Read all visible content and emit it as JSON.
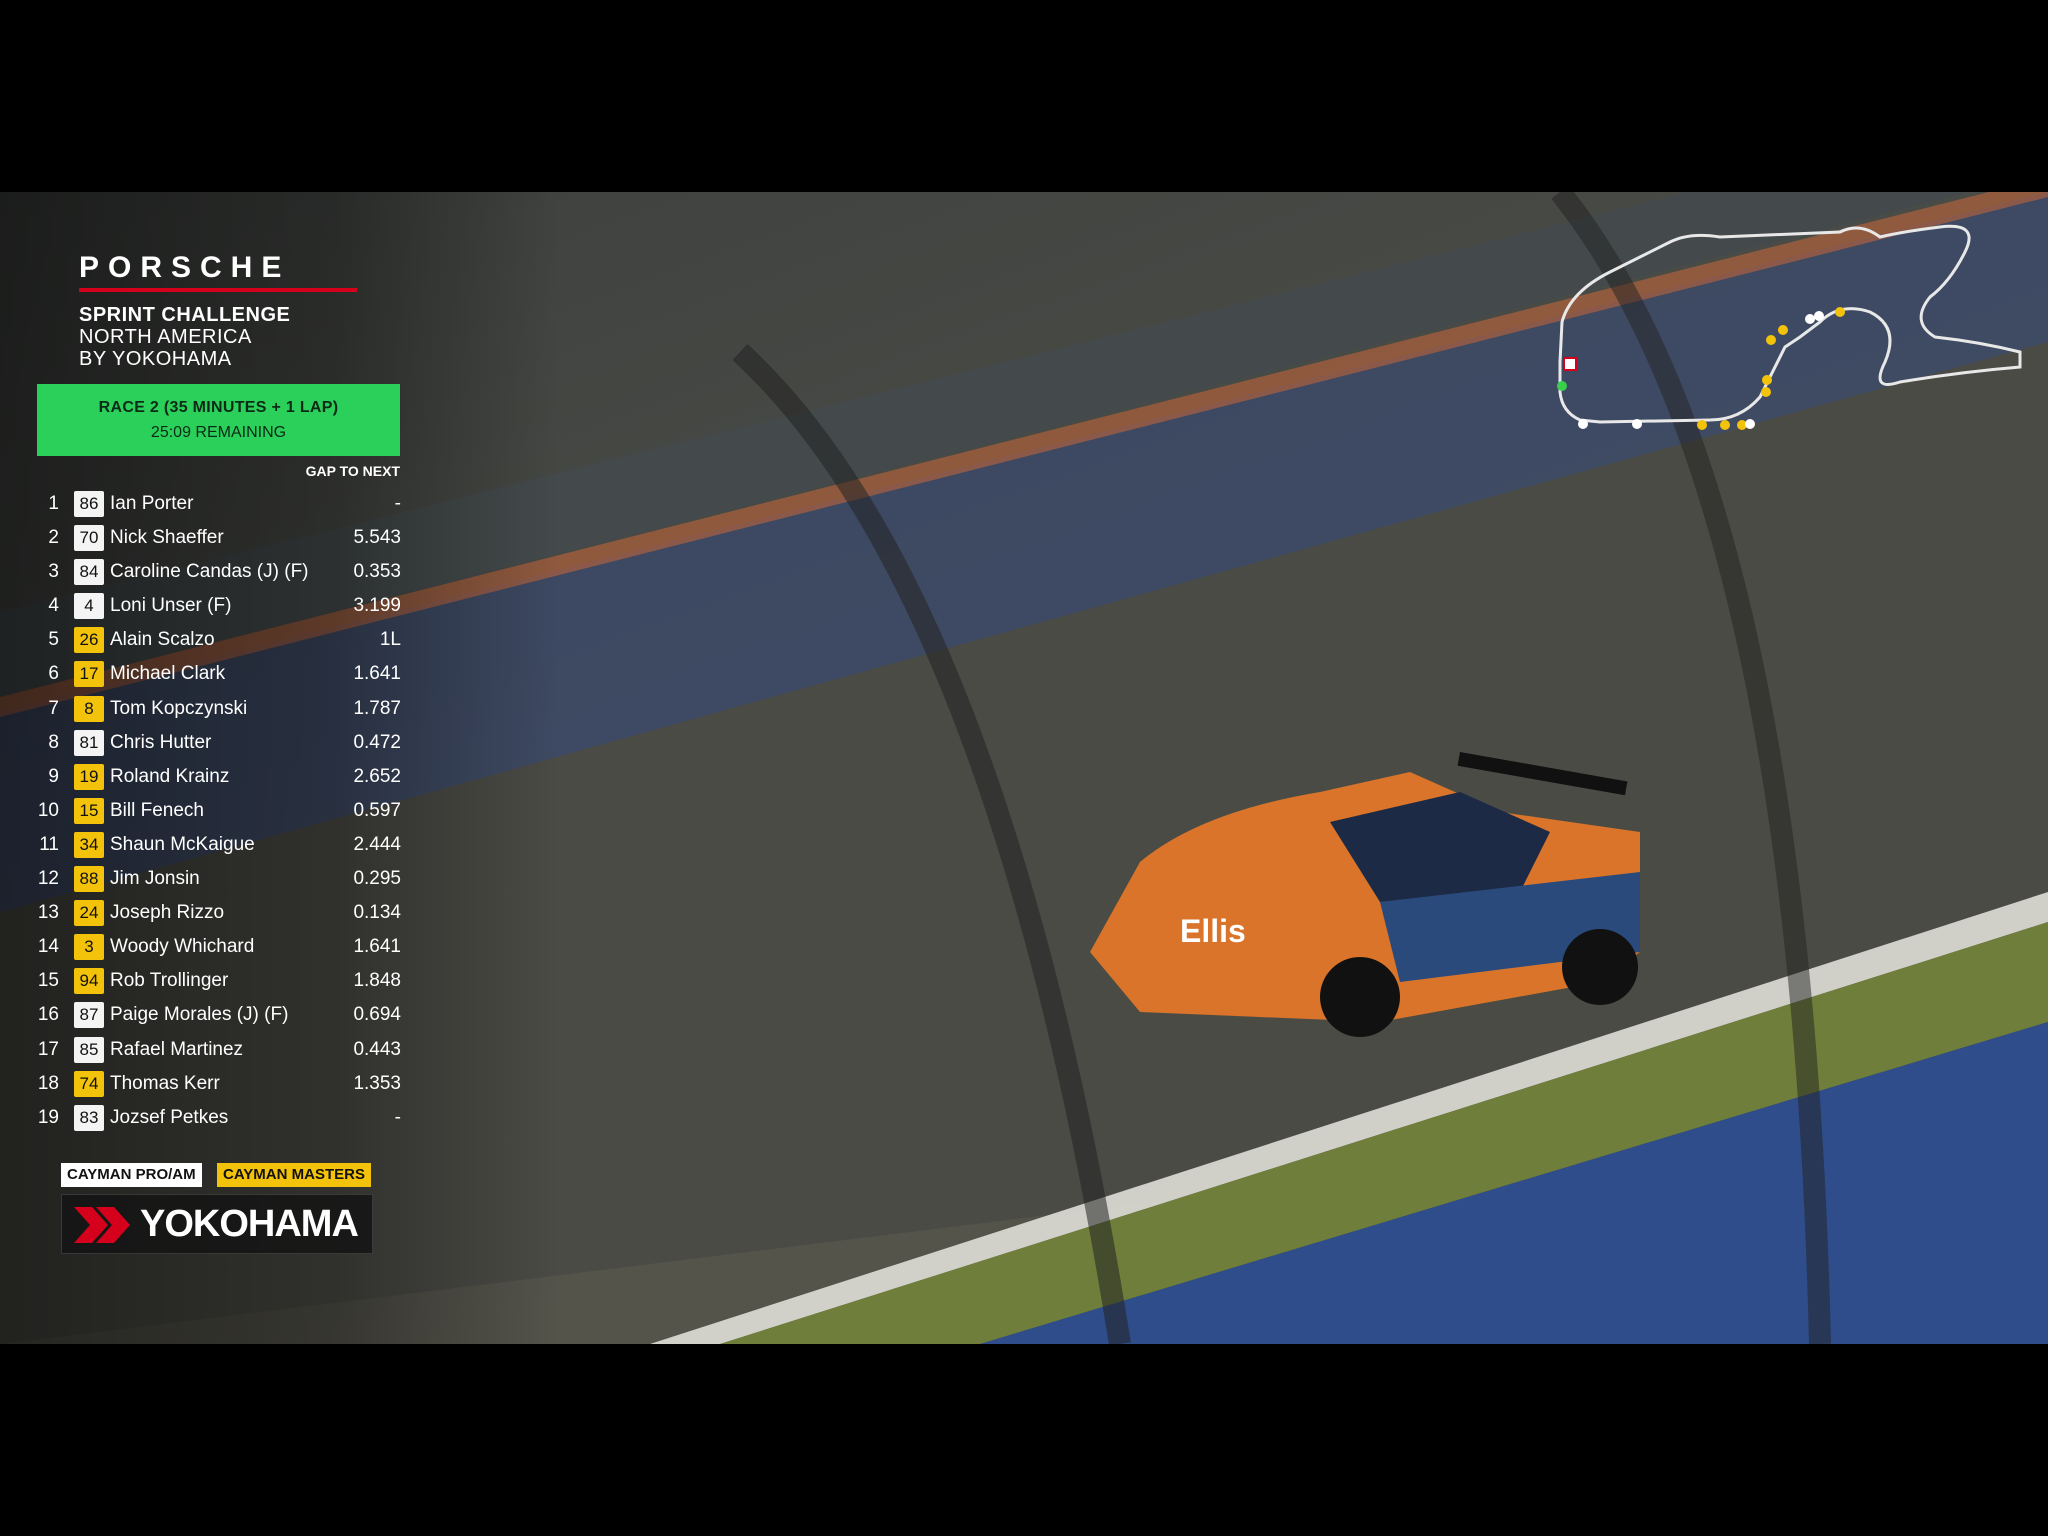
{
  "branding": {
    "porsche": "PORSCHE",
    "series_line1": "SPRINT CHALLENGE",
    "series_line2": "NORTH AMERICA",
    "series_line3": "BY YOKOHAMA"
  },
  "race": {
    "title": "RACE 2 (35 MINUTES + 1 LAP)",
    "remaining": "25:09 REMAINING",
    "banner_color": "#2bd05a"
  },
  "standings": {
    "gap_header": "GAP TO NEXT",
    "rows": [
      {
        "pos": "1",
        "car": "86",
        "driver": "Ian Porter",
        "gap": "-",
        "class": "white"
      },
      {
        "pos": "2",
        "car": "70",
        "driver": "Nick Shaeffer",
        "gap": "5.543",
        "class": "white"
      },
      {
        "pos": "3",
        "car": "84",
        "driver": "Caroline Candas (J) (F)",
        "gap": "0.353",
        "class": "white"
      },
      {
        "pos": "4",
        "car": "4",
        "driver": "Loni Unser (F)",
        "gap": "3.199",
        "class": "white"
      },
      {
        "pos": "5",
        "car": "26",
        "driver": "Alain Scalzo",
        "gap": "1L",
        "class": "yellow"
      },
      {
        "pos": "6",
        "car": "17",
        "driver": "Michael Clark",
        "gap": "1.641",
        "class": "yellow"
      },
      {
        "pos": "7",
        "car": "8",
        "driver": "Tom Kopczynski",
        "gap": "1.787",
        "class": "yellow"
      },
      {
        "pos": "8",
        "car": "81",
        "driver": "Chris Hutter",
        "gap": "0.472",
        "class": "white"
      },
      {
        "pos": "9",
        "car": "19",
        "driver": "Roland Krainz",
        "gap": "2.652",
        "class": "yellow"
      },
      {
        "pos": "10",
        "car": "15",
        "driver": "Bill Fenech",
        "gap": "0.597",
        "class": "yellow"
      },
      {
        "pos": "11",
        "car": "34",
        "driver": "Shaun McKaigue",
        "gap": "2.444",
        "class": "yellow"
      },
      {
        "pos": "12",
        "car": "88",
        "driver": "Jim Jonsin",
        "gap": "0.295",
        "class": "yellow"
      },
      {
        "pos": "13",
        "car": "24",
        "driver": "Joseph Rizzo",
        "gap": "0.134",
        "class": "yellow"
      },
      {
        "pos": "14",
        "car": "3",
        "driver": "Woody Whichard",
        "gap": "1.641",
        "class": "yellow"
      },
      {
        "pos": "15",
        "car": "94",
        "driver": "Rob Trollinger",
        "gap": "1.848",
        "class": "yellow"
      },
      {
        "pos": "16",
        "car": "87",
        "driver": "Paige Morales (J) (F)",
        "gap": "0.694",
        "class": "white"
      },
      {
        "pos": "17",
        "car": "85",
        "driver": "Rafael Martinez",
        "gap": "0.443",
        "class": "white"
      },
      {
        "pos": "18",
        "car": "74",
        "driver": "Thomas Kerr",
        "gap": "1.353",
        "class": "yellow"
      },
      {
        "pos": "19",
        "car": "83",
        "driver": "Jozsef Petkes",
        "gap": "-",
        "class": "white"
      }
    ]
  },
  "class_tags": {
    "pro_am": "CAYMAN PRO/AM",
    "masters": "CAYMAN MASTERS"
  },
  "sponsor": {
    "name": "YOKOHAMA",
    "icon": "yokohama-logo-icon"
  },
  "track_map": {
    "icon": "track-map-icon"
  },
  "colors": {
    "yellow_class": "#f3c20a",
    "white_class": "#f4f4f4",
    "porsche_red": "#d5001c"
  }
}
